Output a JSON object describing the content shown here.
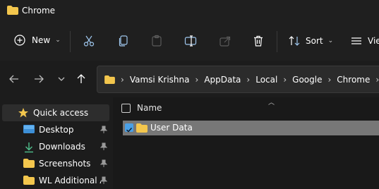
{
  "window": {
    "title": "Chrome"
  },
  "toolbar": {
    "new_label": "New",
    "sort_label": "Sort",
    "view_label": "View"
  },
  "address_bar": {
    "crumbs": [
      "Vamsi Krishna",
      "AppData",
      "Local",
      "Google",
      "Chrome"
    ]
  },
  "sidebar": {
    "items": [
      {
        "label": "Quick access",
        "icon": "star-icon"
      },
      {
        "label": "Desktop",
        "icon": "desktop-icon",
        "pinned": true
      },
      {
        "label": "Downloads",
        "icon": "download-icon",
        "pinned": true
      },
      {
        "label": "Screenshots",
        "icon": "folder-icon",
        "pinned": true
      },
      {
        "label": "WL Additional A",
        "icon": "folder-icon",
        "pinned": true
      }
    ]
  },
  "file_list": {
    "column_name": "Name",
    "rows": [
      {
        "name": "User Data",
        "selected": true
      }
    ]
  },
  "colors": {
    "folder": "#f3c64d",
    "accent": "#4aa0e6",
    "selection": "#777777"
  }
}
